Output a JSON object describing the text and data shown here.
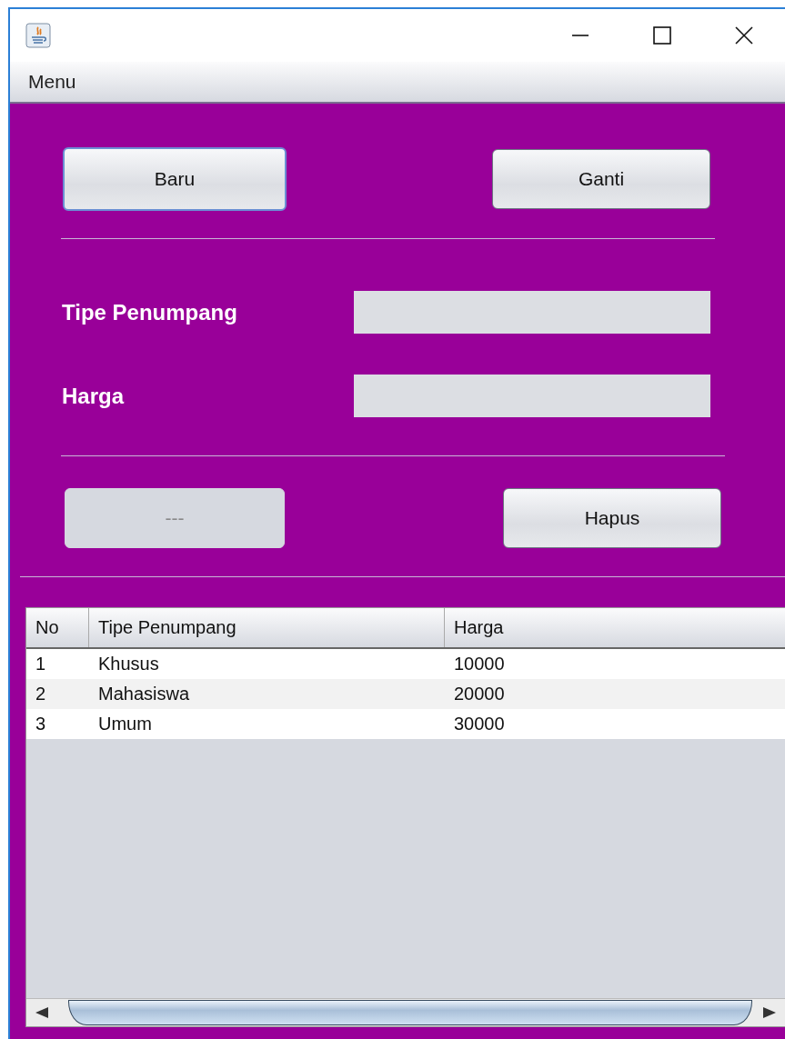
{
  "menu_bar": [
    "Menu"
  ],
  "top_buttons": [
    {
      "label": "Baru",
      "focused": true
    },
    {
      "label": "Ganti",
      "focused": false
    }
  ],
  "fields": [
    {
      "label": "Tipe Penumpang"
    },
    {
      "label": "Harga"
    }
  ],
  "bottom_buttons": [
    {
      "label": "---",
      "disabled": true
    },
    {
      "label": "Hapus",
      "disabled": false
    }
  ],
  "table": {
    "columns": [
      "No",
      "Tipe Penumpang",
      "Harga"
    ],
    "rows": [
      [
        "1",
        "Khusus",
        "10000"
      ],
      [
        "2",
        "Mahasiswa",
        "20000"
      ],
      [
        "3",
        "Umum",
        "30000"
      ]
    ]
  }
}
